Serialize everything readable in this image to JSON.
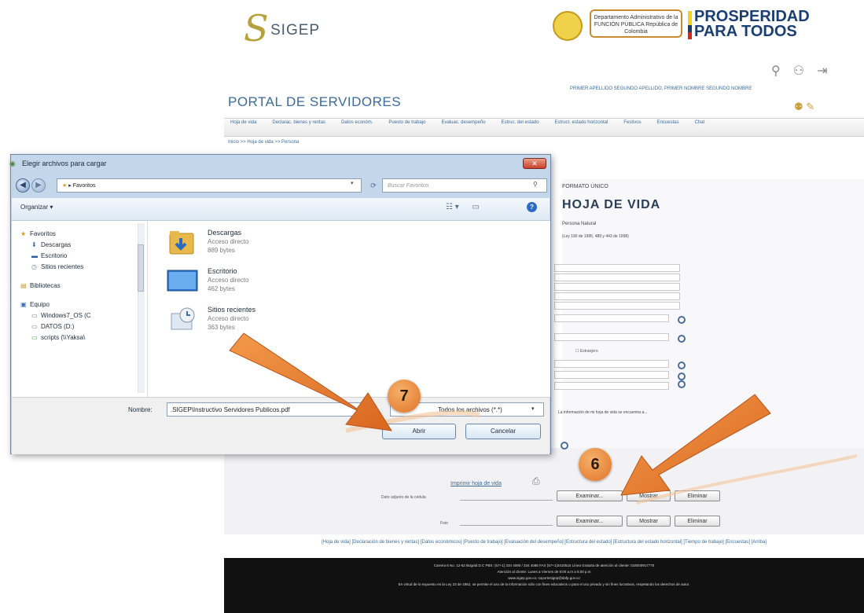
{
  "portal": {
    "logo_text": "SIGEP",
    "funcion_publica": "Departamento Administrativo de la FUNCIÓN PÚBLICA República de Colombia",
    "prosperidad_line1": "PROSPERIDAD",
    "prosperidad_line2": "PARA TODOS",
    "title": "PORTAL DE SERVIDORES",
    "user_names": "PRIMER APELLIDO SEGUNDO APELLIDO, PRIMER NOMBRE SEGUNDO NOMBRE",
    "nav": [
      "Hoja de vida",
      "Declarac. bienes y rentas",
      "Datos económ.",
      "Puesto de trabajo",
      "Evaluac. desempeño",
      "Estruc. del estado",
      "Estruct. estado horizontal",
      "Festivos",
      "Encuestas",
      "Chat"
    ],
    "breadcrumb": "Inicio >> Hoja de vida >> Persona",
    "formato": "FORMATO ÚNICO",
    "hoja_de_vida": "HOJA DE VIDA",
    "persona_natural": "Persona Natural",
    "ley": "(Ley 190 de 1995, 489 y 443 de 1998)",
    "fields": [
      "",
      "",
      "",
      "",
      "",
      "",
      "",
      "",
      "",
      ""
    ],
    "extranjero": "Extranjero",
    "info_line": "La información de mi hoja de vida se encuentra a...",
    "imprimir": "Imprimir hoja de vida",
    "rows": [
      {
        "label": "Dato adjunto de la cédula",
        "examinar": "Examinar...",
        "mostrar": "Mostrar",
        "eliminar": "Eliminar"
      },
      {
        "label": "Foto",
        "examinar": "Examinar...",
        "mostrar": "Mostrar",
        "eliminar": "Eliminar"
      }
    ],
    "footer_links": "[Hoja de vida] [Declaración de bienes y rentas] [Datos económicos] [Puesto de trabajo] [Evaluación del desempeño] [Estructura del estado] [Estructura del estado horizontal] [Tiempo de trabajo] [Encuestas] [Arriba]",
    "footer_line1": "Carrera 6 No. 12-62 Bogotá D.C PBX: (57+1) 334 4080 / 334 4086 FAX (57+1)3410515 Línea Gratuita de atención al cliente: 018000917770",
    "footer_line2": "Atención al cliente: Lunes a Viernes de 8:00 a.m a 5:00 p.m",
    "footer_line3": "www.sigep.gov.co; soportesigep@dafp.gov.co",
    "footer_line4": "En virtud de lo expuesto en la Ley 23 de 1982, se permite el uso de la información sólo con fines educativos o para el uso privado y sin fines lucrativos, respetando los derechos de autor."
  },
  "dialog": {
    "title": "Elegir archivos para cargar",
    "address": "▸ Favoritos",
    "search_placeholder": "Buscar Favoritos",
    "organizar": "Organizar ▾",
    "nav_items": [
      {
        "label": "Favoritos",
        "icon": "★"
      },
      {
        "label": "Descargas",
        "icon": "⬇"
      },
      {
        "label": "Escritorio",
        "icon": "▬"
      },
      {
        "label": "Sitios recientes",
        "icon": "◷"
      },
      {
        "label": "Bibliotecas",
        "icon": "▤"
      },
      {
        "label": "Equipo",
        "icon": "▣"
      },
      {
        "label": "Windows7_OS (C",
        "icon": "▭"
      },
      {
        "label": "DATOS (D:)",
        "icon": "▭"
      },
      {
        "label": "scripts (\\\\Yaksa\\",
        "icon": "▭"
      }
    ],
    "files": [
      {
        "name": "Descargas",
        "type": "Acceso directo",
        "size": "889 bytes"
      },
      {
        "name": "Escritorio",
        "type": "Acceso directo",
        "size": "462 bytes"
      },
      {
        "name": "Sitios recientes",
        "type": "Acceso directo",
        "size": "363 bytes"
      }
    ],
    "nombre_label": "Nombre:",
    "nombre_value": ".SIGEP\\Instructivo Servidores Publicos.pdf",
    "filter_value": "Todos los archivos (*.*)",
    "abrir": "Abrir",
    "cancelar": "Cancelar"
  },
  "annotations": {
    "step7": "7",
    "step6": "6",
    "arrow_color": "#e98a3a"
  }
}
